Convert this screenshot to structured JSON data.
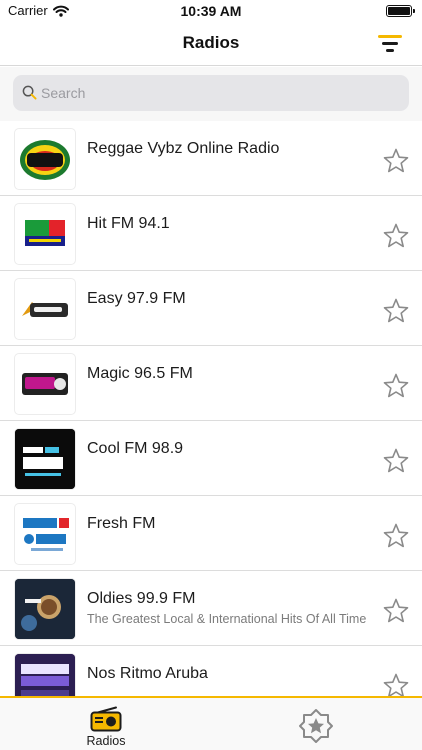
{
  "status_bar": {
    "carrier": "Carrier",
    "time": "10:39 AM"
  },
  "nav": {
    "title": "Radios"
  },
  "search": {
    "placeholder": "Search"
  },
  "radios": [
    {
      "name": "Reggae Vybz Online Radio",
      "description": "",
      "logo_text": "Reggae Vybz Radio",
      "favorite": false
    },
    {
      "name": "Hit FM 94.1",
      "description": "",
      "logo_text": "HIT 94 FM",
      "favorite": false
    },
    {
      "name": "Easy 97.9 FM",
      "description": "",
      "logo_text": "easy",
      "favorite": false
    },
    {
      "name": "Magic 96.5 FM",
      "description": "",
      "logo_text": "magic",
      "favorite": false
    },
    {
      "name": "Cool FM 98.9",
      "description": "",
      "logo_text": "COOL FM 98.9",
      "favorite": false
    },
    {
      "name": "Fresh FM",
      "description": "",
      "logo_text": "FRESH 104.3",
      "favorite": false
    },
    {
      "name": "Oldies 99.9 FM",
      "description": "The Greatest Local & International Hits Of All Time",
      "logo_text": "Oldies 99.9",
      "favorite": false
    },
    {
      "name": "Nos Ritmo Aruba",
      "description": "",
      "logo_text": "NOS RITMO",
      "favorite": false
    }
  ],
  "tabs": [
    {
      "label": "Radios",
      "active": true
    },
    {
      "label": "",
      "active": false
    }
  ],
  "colors": {
    "accent": "#f5b800",
    "text": "#1c1c1c",
    "secondary_text": "#7b7b7b",
    "separator": "#dcdcdc"
  },
  "icons": {
    "wifi": "wifi-icon",
    "battery": "battery-icon",
    "filter": "filter-icon",
    "search": "search-icon",
    "favorite": "star-icon",
    "radio_tab": "radio-icon",
    "favorites_tab": "star-badge-icon"
  }
}
